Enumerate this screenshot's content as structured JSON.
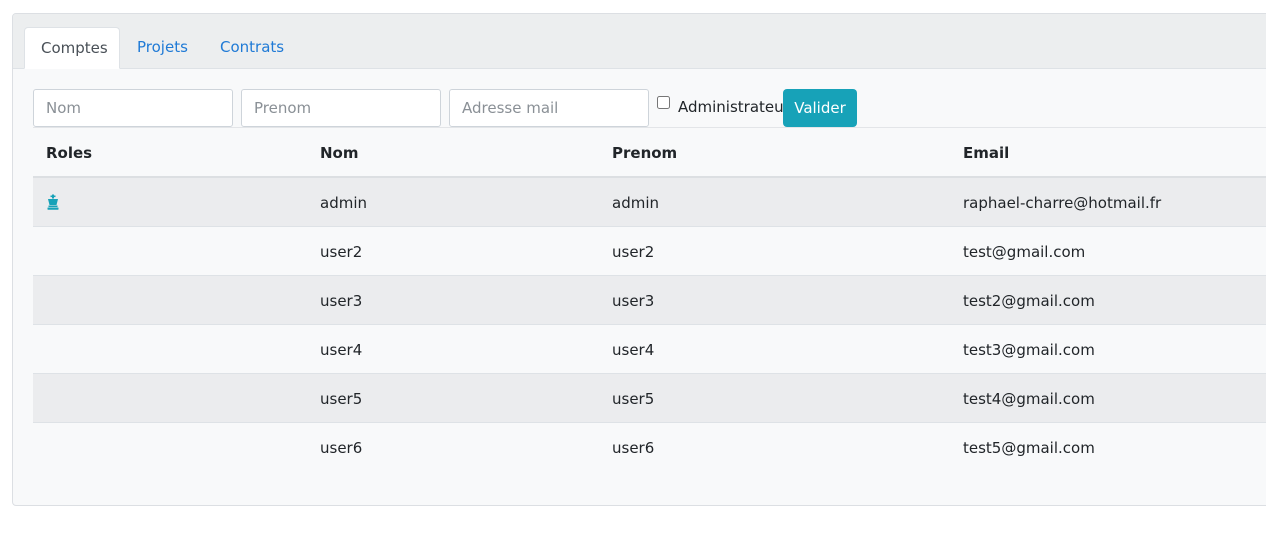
{
  "tabs": [
    {
      "label": "Comptes",
      "active": true
    },
    {
      "label": "Projets",
      "active": false
    },
    {
      "label": "Contrats",
      "active": false
    }
  ],
  "form": {
    "nom_placeholder": "Nom",
    "prenom_placeholder": "Prenom",
    "mail_placeholder": "Adresse mail",
    "admin_label": "Administrateur",
    "admin_checked": false,
    "submit_label": "Valider"
  },
  "table": {
    "headers": {
      "roles": "Roles",
      "nom": "Nom",
      "prenom": "Prenom",
      "email": "Email"
    },
    "rows": [
      {
        "role_icon": "chess-king-icon",
        "nom": "admin",
        "prenom": "admin",
        "email": "raphael-charre@hotmail.fr"
      },
      {
        "role_icon": "",
        "nom": "user2",
        "prenom": "user2",
        "email": "test@gmail.com"
      },
      {
        "role_icon": "",
        "nom": "user3",
        "prenom": "user3",
        "email": "test2@gmail.com"
      },
      {
        "role_icon": "",
        "nom": "user4",
        "prenom": "user4",
        "email": "test3@gmail.com"
      },
      {
        "role_icon": "",
        "nom": "user5",
        "prenom": "user5",
        "email": "test4@gmail.com"
      },
      {
        "role_icon": "",
        "nom": "user6",
        "prenom": "user6",
        "email": "test5@gmail.com"
      }
    ]
  },
  "colors": {
    "accent": "#17a2b8",
    "link": "#1f7ad6",
    "row_stripe": "#ebecee"
  }
}
